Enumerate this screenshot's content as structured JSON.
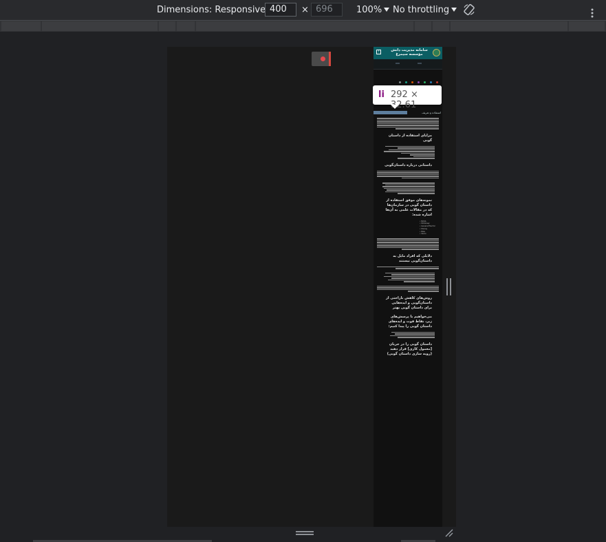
{
  "toolbar": {
    "dimensions_label": "Dimensions: Responsive",
    "width_value": "400",
    "height_value": "696",
    "times_sign": "×",
    "zoom_label": "100%",
    "throttling_label": "No throttling",
    "rotate_icon": "rotate-icon",
    "more_icon": "more-vert-icon"
  },
  "tooltip": {
    "tag": "li",
    "size": "292 × 32.61"
  },
  "site": {
    "title": "سامانه مدیریت دانش مؤسسه سیمرغ",
    "selected_item": "استفاده و تعریف"
  },
  "article": {
    "headings": [
      "مزایای استفاده از داستان گویی",
      "داستانی درباره داستان‌گویی",
      "نمونه‌های موفق استفاده از داستان گویی در سازمان‌ها که در مقالات علمی به آن‌ها اشاره شده:",
      "دلایلی که افراد مایل به داستان‌گویی نیستند",
      "روش‌های کاهش ناراحتی از داستان‌گویی و ایده‌هایی برای داستان گویی بهتر",
      "می‌خواهیم با پرسش‌های زیر، نقاط قوت و ایده‌های داستان گویی را پیدا کنیم:",
      "داستان گویی را در جریان [معمول کاری] قرار دهید (رویه سازی داستان گویی)"
    ],
    "ltr_list": [
      "NASA",
      "McKinsey",
      "General Electric",
      "Disney",
      "Nike",
      "Xerox"
    ]
  },
  "colors": {
    "devtools_bg": "#202124",
    "header_teal": "#0b5e63",
    "highlight": "#5e7f9e",
    "tag_purple": "#881280"
  }
}
